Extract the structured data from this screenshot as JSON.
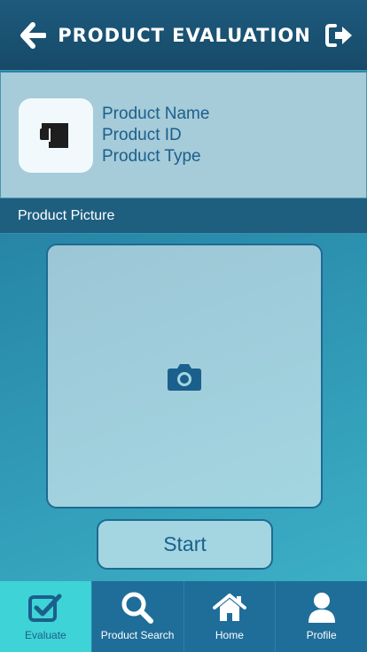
{
  "header": {
    "title": "PRODUCT EVALUATION",
    "back_icon": "arrow-left-icon",
    "exit_icon": "sign-out-icon"
  },
  "product": {
    "thumbnail_icon": "mug-icon",
    "name_label": "Product Name",
    "id_label": "Product ID",
    "type_label": "Product Type"
  },
  "section": {
    "picture_label": "Product Picture"
  },
  "camera": {
    "icon": "camera-icon"
  },
  "actions": {
    "start_label": "Start"
  },
  "tabs": [
    {
      "label": "Evaluate",
      "icon": "checkbox-icon",
      "active": true
    },
    {
      "label": "Product Search",
      "icon": "search-icon",
      "active": false
    },
    {
      "label": "Home",
      "icon": "home-icon",
      "active": false
    },
    {
      "label": "Profile",
      "icon": "user-icon",
      "active": false
    }
  ],
  "colors": {
    "header_bg": "#174a68",
    "accent": "#3ed3d6",
    "text_blue": "#1b5f8c",
    "card_bg": "#a6cbd9"
  }
}
